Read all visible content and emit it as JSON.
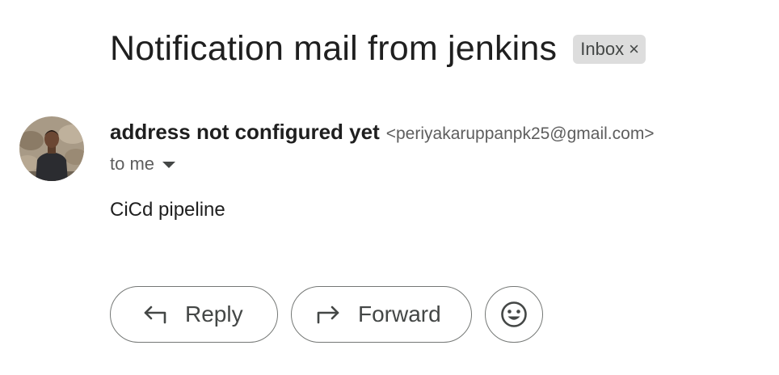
{
  "email": {
    "subject": "Notification mail from jenkins",
    "label": "Inbox",
    "label_remove_glyph": "×",
    "sender_name": "address not configured yet",
    "sender_email": "<periyakaruppanpk25@gmail.com>",
    "recipient": "to me",
    "body": "CiCd pipeline"
  },
  "actions": {
    "reply_label": "Reply",
    "forward_label": "Forward"
  },
  "icons": {
    "reply": "reply-icon",
    "forward": "forward-icon",
    "emoji": "emoji-reaction-icon",
    "caret": "chevron-down-icon"
  },
  "colors": {
    "chip_background": "#dddddd",
    "button_border": "#747775",
    "secondary_text": "#5e5e5e"
  }
}
